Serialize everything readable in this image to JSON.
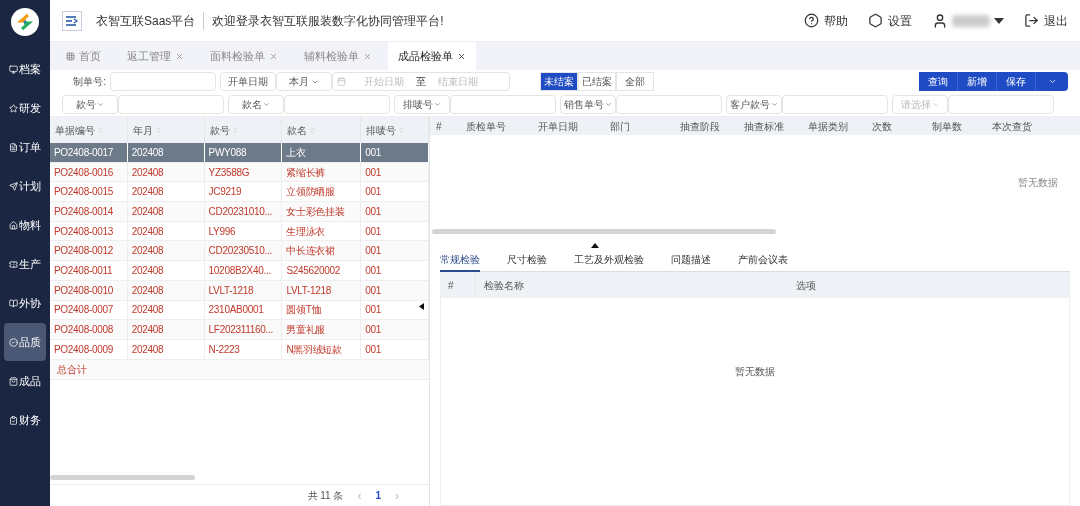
{
  "header": {
    "platform": "衣智互联Saas平台",
    "welcome": "欢迎登录衣智互联服装数字化协同管理平台!",
    "actions": [
      {
        "kind": "help",
        "label": "帮助"
      },
      {
        "kind": "settings",
        "label": "设置"
      },
      {
        "kind": "user"
      },
      {
        "kind": "logout",
        "label": "退出"
      }
    ]
  },
  "sidebar": [
    {
      "label": "档案",
      "selected": false
    },
    {
      "label": "研发",
      "selected": false
    },
    {
      "label": "订单",
      "selected": false
    },
    {
      "label": "计划",
      "selected": false
    },
    {
      "label": "物料",
      "selected": false
    },
    {
      "label": "生产",
      "selected": false
    },
    {
      "label": "外协",
      "selected": false
    },
    {
      "label": "品质",
      "selected": true
    },
    {
      "label": "成品",
      "selected": false
    },
    {
      "label": "财务",
      "selected": false
    }
  ],
  "tabs": [
    {
      "label": "首页",
      "closable": false,
      "selected": false
    },
    {
      "label": "返工管理",
      "closable": true,
      "selected": false
    },
    {
      "label": "面料检验单",
      "closable": true,
      "selected": false
    },
    {
      "label": "辅料检验单",
      "closable": true,
      "selected": false
    },
    {
      "label": "成品检验单",
      "closable": true,
      "selected": true
    }
  ],
  "filters": {
    "order_no_label": "制单号:",
    "date_type": "开单日期",
    "period": "本月",
    "start_placeholder": "开始日期",
    "to": "至",
    "end_placeholder": "结束日期",
    "status": [
      {
        "label": "未结案",
        "selected": true
      },
      {
        "label": "已结案",
        "selected": false
      },
      {
        "label": "全部",
        "selected": false
      }
    ],
    "buttons": [
      "查询",
      "新增",
      "保存"
    ],
    "row2": [
      {
        "label": "款号",
        "placeholder_style": false
      },
      {
        "label": "款名",
        "placeholder_style": false
      },
      {
        "label": "排唛号",
        "placeholder_style": false
      },
      {
        "label": "销售单号",
        "placeholder_style": false
      },
      {
        "label": "客户款号",
        "placeholder_style": false
      },
      {
        "label": "请选择",
        "placeholder_style": true
      }
    ]
  },
  "left_table": {
    "columns": [
      "单据编号",
      "年月",
      "款号",
      "款名",
      "排唛号"
    ],
    "rows": [
      {
        "cells": [
          "PO2408-0017",
          "202408",
          "PWY088",
          "上衣",
          "001"
        ],
        "selected": true
      },
      {
        "cells": [
          "PO2408-0016",
          "202408",
          "YZ3588G",
          "紧缩长裤",
          "001"
        ],
        "selected": false
      },
      {
        "cells": [
          "PO2408-0015",
          "202408",
          "JC9219",
          "立领防晒服",
          "001"
        ],
        "selected": false
      },
      {
        "cells": [
          "PO2408-0014",
          "202408",
          "CD20231010...",
          "女士彩色挂装",
          "001"
        ],
        "selected": false
      },
      {
        "cells": [
          "PO2408-0013",
          "202408",
          "LY996",
          "生理泳衣",
          "001"
        ],
        "selected": false
      },
      {
        "cells": [
          "PO2408-0012",
          "202408",
          "CD20230510...",
          "中长连衣裙",
          "001"
        ],
        "selected": false
      },
      {
        "cells": [
          "PO2408-0011",
          "202408",
          "10208B2X40...",
          "S245620002",
          "001"
        ],
        "selected": false
      },
      {
        "cells": [
          "PO2408-0010",
          "202408",
          "LVLT-1218",
          "LVLT-1218",
          "001"
        ],
        "selected": false
      },
      {
        "cells": [
          "PO2408-0007",
          "202408",
          "2310AB0001",
          "圆领T恤",
          "001"
        ],
        "selected": false
      },
      {
        "cells": [
          "PO2408-0008",
          "202408",
          "LF202311160...",
          "男童礼服",
          "001"
        ],
        "selected": false
      },
      {
        "cells": [
          "PO2408-0009",
          "202408",
          "N-2223",
          "N黑羽绒短款",
          "001"
        ],
        "selected": false
      }
    ],
    "total_label": "总合计",
    "pagination": {
      "total": "共 11 条",
      "prev": "‹",
      "page": "1",
      "next": "›"
    }
  },
  "right_table": {
    "columns": [
      "#",
      "质检单号",
      "开单日期",
      "部门",
      "抽查阶段",
      "抽查标准",
      "单据类别",
      "次数",
      "制单数",
      "本次查货"
    ],
    "empty": "暂无数据"
  },
  "detail_tabs": [
    {
      "label": "常规检验",
      "selected": true
    },
    {
      "label": "尺寸检验",
      "selected": false
    },
    {
      "label": "工艺及外观检验",
      "selected": false
    },
    {
      "label": "问题描述",
      "selected": false
    },
    {
      "label": "产前会议表",
      "selected": false
    }
  ],
  "detail_table": {
    "columns": [
      "#",
      "检验名称",
      "选项"
    ],
    "empty": "暂无数据"
  }
}
